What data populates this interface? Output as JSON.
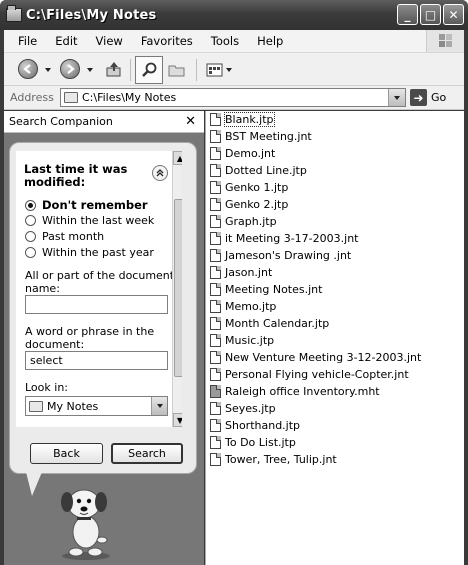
{
  "window": {
    "title": "C:\\Files\\My Notes",
    "buttons": {
      "minimize": "_",
      "maximize": "□",
      "close": "✕"
    }
  },
  "menu": [
    "File",
    "Edit",
    "View",
    "Favorites",
    "Tools",
    "Help"
  ],
  "toolbar": {
    "back_icon": "back-arrow-icon",
    "forward_icon": "forward-arrow-icon",
    "up_icon": "up-folder-icon",
    "search_icon": "search-icon",
    "folders_icon": "folders-icon",
    "views_icon": "views-icon"
  },
  "address": {
    "label": "Address",
    "value": "C:\\Files\\My Notes",
    "go_label": "Go"
  },
  "search_companion": {
    "title": "Search Companion",
    "close": "✕",
    "section_title": "Last time it was modified:",
    "options": [
      "Don't remember",
      "Within the last week",
      "Past month",
      "Within the past year"
    ],
    "selected_option": "Don't remember",
    "name_label": "All or part of the document name:",
    "name_value": "",
    "phrase_label": "A word or phrase in the document:",
    "phrase_value": "select",
    "look_in_label": "Look in:",
    "look_in_value": "My Notes",
    "back_button": "Back",
    "search_button": "Search"
  },
  "files": [
    "Blank.jtp",
    "BST Meeting.jnt",
    "Demo.jnt",
    "Dotted Line.jtp",
    "Genko 1.jtp",
    "Genko 2.jtp",
    "Graph.jtp",
    "it Meeting 3-17-2003.jnt",
    "Jameson's Drawing .jnt",
    "Jason.jnt",
    "Meeting Notes.jnt",
    "Memo.jtp",
    "Month Calendar.jtp",
    "Music.jtp",
    "New Venture Meeting 3-12-2003.jnt",
    "Personal Flying vehicle-Copter.jnt",
    "Raleigh office Inventory.mht",
    "Seyes.jtp",
    "Shorthand.jtp",
    "To Do List.jtp",
    "Tower, Tree, Tulip.jnt"
  ]
}
